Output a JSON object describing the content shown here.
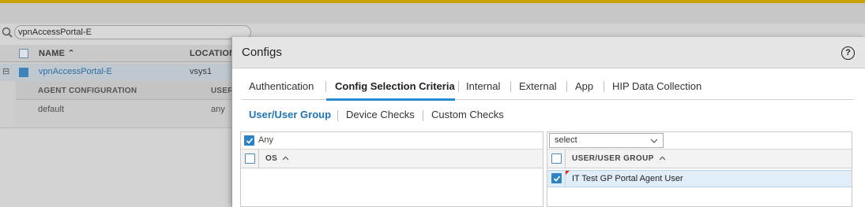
{
  "background": {
    "search_value": "vpnAccessPortal-E",
    "table": {
      "headers": [
        "NAME",
        "LOCATION"
      ],
      "row": {
        "name": "vpnAccessPortal-E",
        "location": "vsys1"
      },
      "sub_headers": [
        "AGENT CONFIGURATION",
        "USER"
      ],
      "sub_row": [
        "default",
        "any"
      ]
    }
  },
  "modal": {
    "title": "Configs",
    "help_icon": "question-circle-icon",
    "tabs": [
      "Authentication",
      "Config Selection Criteria",
      "Internal",
      "External",
      "App",
      "HIP Data Collection"
    ],
    "active_tab": "Config Selection Criteria",
    "subtabs": [
      "User/User Group",
      "Device Checks",
      "Custom Checks"
    ],
    "active_subtab": "User/User Group",
    "os_panel": {
      "any_label": "Any",
      "any_checked": true,
      "column_header": "OS"
    },
    "user_panel": {
      "select_value": "select",
      "column_header": "USER/USER GROUP",
      "rows": [
        {
          "label": "IT Test GP Portal Agent User",
          "checked": true
        }
      ]
    }
  },
  "colors": {
    "accent": "#2a8ad0",
    "active_subtab": "#1f74b6",
    "selected_row": "#e1eef9",
    "top_bar": "#c8a000"
  }
}
